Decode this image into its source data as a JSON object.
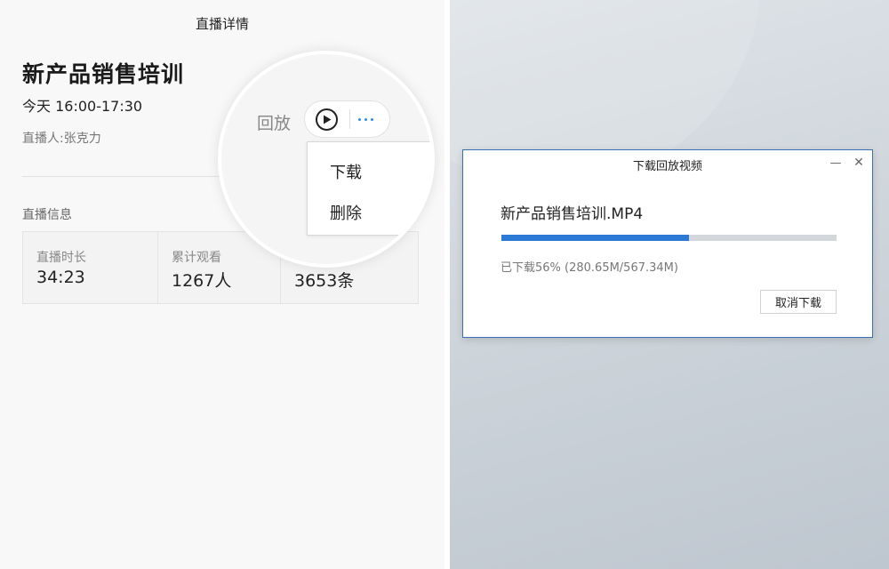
{
  "header": {
    "title": "直播详情"
  },
  "live": {
    "title": "新产品销售培训",
    "time": "今天 16:00-17:30",
    "host": "直播人:张克力"
  },
  "info": {
    "section_label": "直播信息",
    "stats": [
      {
        "label": "直播时长",
        "value": "34:23"
      },
      {
        "label": "累计观看",
        "value": "1267人"
      },
      {
        "label": "",
        "value": "3653条"
      }
    ]
  },
  "magnifier": {
    "replay_label": "回放",
    "play_icon": "play-circle-icon",
    "more_icon": "more-dots-icon",
    "menu": [
      {
        "label": "下载"
      },
      {
        "label": "删除"
      }
    ]
  },
  "dialog": {
    "title": "下载回放视频",
    "minimize_label": "—",
    "close_label": "✕",
    "file_name": "新产品销售培训.MP4",
    "progress_percent": 56,
    "progress_text": "已下载56% (280.65M/567.34M)",
    "cancel_label": "取消下载"
  },
  "colors": {
    "accent": "#2d7ad6",
    "dialog_border": "#3b6fb6",
    "more_dots": "#2b8ee8"
  }
}
